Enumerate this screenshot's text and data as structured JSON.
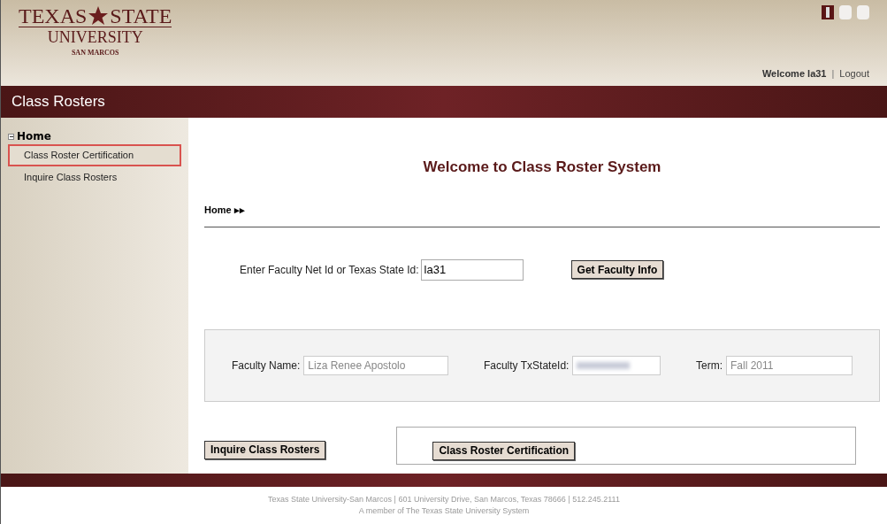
{
  "logo": {
    "line1a": "TEXAS",
    "line1b": "STATE",
    "line2": "UNIVERSITY",
    "line3": "SAN MARCOS"
  },
  "header": {
    "welcome": "Welcome la31",
    "separator": "|",
    "logout": "Logout"
  },
  "title_bar": {
    "title": "Class Rosters"
  },
  "sidebar": {
    "root": {
      "label": "Home",
      "expanded": true,
      "children": [
        {
          "label": "Class Roster Certification",
          "selected": true
        },
        {
          "label": "Inquire Class Rosters",
          "selected": false
        }
      ]
    }
  },
  "main": {
    "heading": "Welcome to Class Roster System",
    "breadcrumb": "Home ▸▸",
    "lookup": {
      "label": "Enter Faculty Net Id or Texas State Id:",
      "value": "la31",
      "button": "Get Faculty Info"
    },
    "info_fields": [
      {
        "kind": "text",
        "label": "Faculty Name:",
        "value": "Liza Renee Apostolo"
      },
      {
        "kind": "redacted",
        "label": "Faculty TxStateId:"
      },
      {
        "kind": "text",
        "label": "Term:",
        "value": "Fall 2011"
      }
    ],
    "actions": [
      "Inquire Class Rosters",
      "Class Roster Certification"
    ]
  },
  "footer": {
    "line1": "Texas State University-San Marcos | 601 University Drive, San Marcos, Texas 78666 | 512.245.2111",
    "line2": "A member of The Texas State University System"
  }
}
